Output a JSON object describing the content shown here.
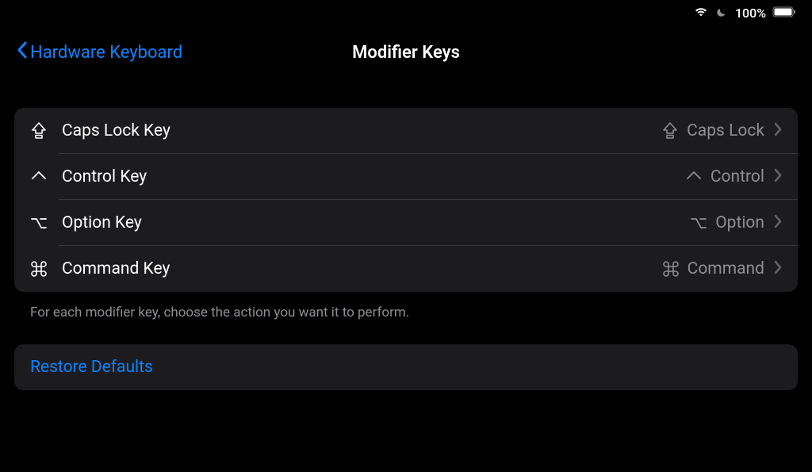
{
  "status_bar": {
    "battery_percent": "100%"
  },
  "nav": {
    "back_label": "Hardware Keyboard",
    "title": "Modifier Keys"
  },
  "rows": [
    {
      "label": "Caps Lock Key",
      "icon": "capslock",
      "value": "Caps Lock",
      "value_icon": "capslock"
    },
    {
      "label": "Control Key",
      "icon": "control",
      "value": "Control",
      "value_icon": "control"
    },
    {
      "label": "Option Key",
      "icon": "option",
      "value": "Option",
      "value_icon": "option"
    },
    {
      "label": "Command Key",
      "icon": "command",
      "value": "Command",
      "value_icon": "command"
    }
  ],
  "footer_text": "For each modifier key, choose the action you want it to perform.",
  "restore_button_label": "Restore Defaults"
}
